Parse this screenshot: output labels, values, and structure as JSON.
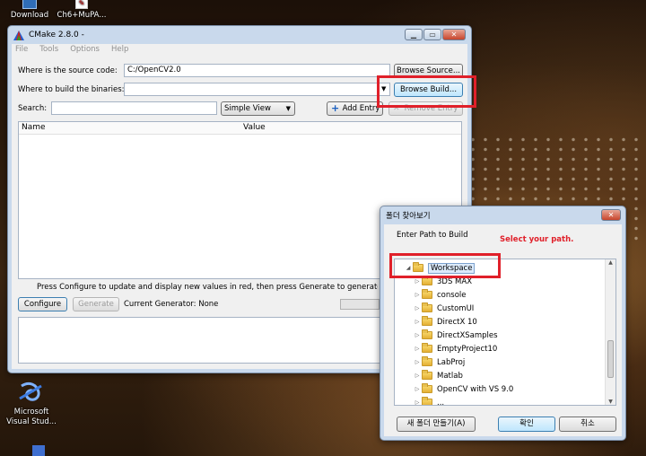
{
  "desktop": {
    "icons": [
      {
        "label": "Download",
        "icon": "shortcut-icon"
      },
      {
        "label": "Ch6+MuPA...",
        "icon": "pdf-icon"
      },
      {
        "label": "Microsoft Visual Stud...",
        "icon": "visual-studio-icon"
      }
    ]
  },
  "cmake": {
    "title": "CMake 2.8.0 -",
    "menu": [
      "File",
      "Tools",
      "Options",
      "Help"
    ],
    "source_label": "Where is the source code:",
    "source_value": "C:/OpenCV2.0",
    "browse_source": "Browse Source...",
    "binaries_label": "Where to build the binaries:",
    "binaries_value": "",
    "browse_build": "Browse Build...",
    "search_label": "Search:",
    "search_value": "",
    "view_select": "Simple View",
    "add_entry": "Add Entry",
    "remove_entry": "Remove Entry",
    "table_headers": [
      "Name",
      "Value"
    ],
    "hint": "Press Configure to update and display new values in red, then press Generate to generate selected build files.",
    "configure": "Configure",
    "generate": "Generate",
    "current_generator": "Current Generator: None"
  },
  "folder_dialog": {
    "title": "폴더 찾아보기",
    "prompt": "Enter Path to Build",
    "annotation": "Select your path.",
    "annotation_color": "#e0202a",
    "tree": [
      {
        "label": "Workspace",
        "expanded": true,
        "selected": true,
        "level": 0
      },
      {
        "label": "3DS MAX",
        "level": 1
      },
      {
        "label": "console",
        "level": 1
      },
      {
        "label": "CustomUI",
        "level": 1
      },
      {
        "label": "DirectX 10",
        "level": 1
      },
      {
        "label": "DirectXSamples",
        "level": 1
      },
      {
        "label": "EmptyProject10",
        "level": 1
      },
      {
        "label": "LabProj",
        "level": 1
      },
      {
        "label": "Matlab",
        "level": 1
      },
      {
        "label": "OpenCV with VS 9.0",
        "level": 1
      },
      {
        "label": "...",
        "level": 1
      }
    ],
    "new_folder": "새 폴더 만들기(A)",
    "ok": "확인",
    "cancel": "취소"
  }
}
